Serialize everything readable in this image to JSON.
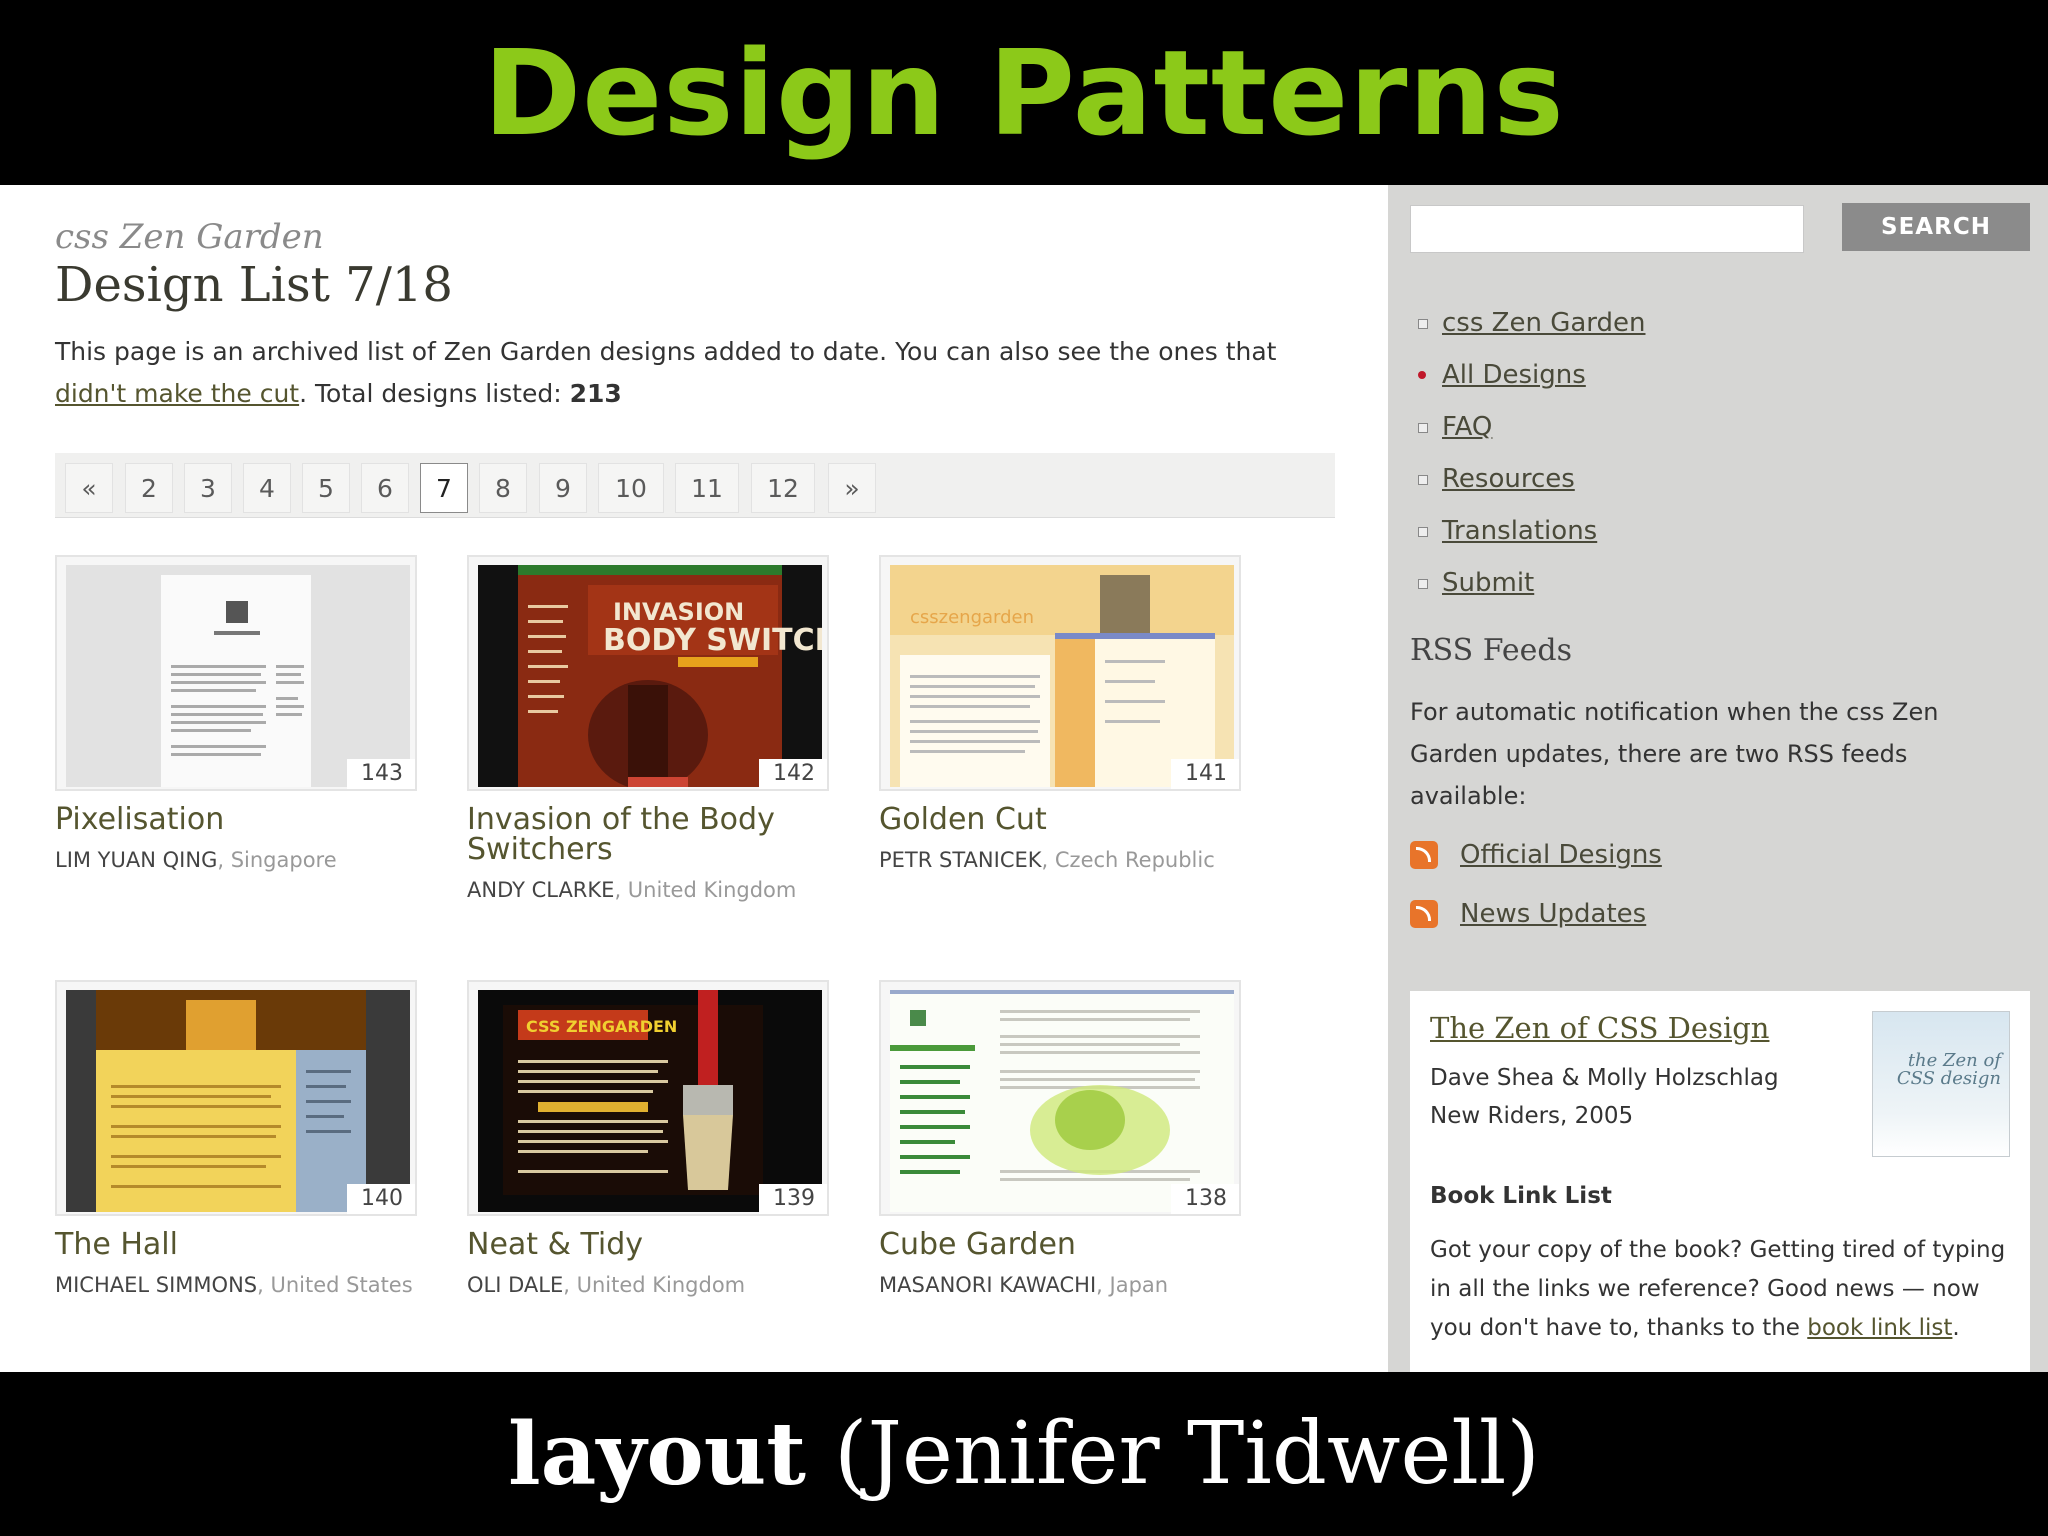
{
  "slide": {
    "title": "Design Patterns",
    "footer_bold": "layout",
    "footer_rest": "(Jenifer Tidwell)"
  },
  "main": {
    "brand": "css Zen Garden",
    "page_title": "Design List 7/18",
    "intro_pre": "This page is an archived list of Zen Garden designs added to date. You can also see the ones that",
    "intro_link": "didn't make the cut",
    "intro_mid": ". Total designs listed: ",
    "intro_count": "213",
    "pager": [
      "«",
      "2",
      "3",
      "4",
      "5",
      "6",
      "7",
      "8",
      "9",
      "10",
      "11",
      "12",
      "»"
    ],
    "pager_current": "7",
    "designs": [
      {
        "num": "143",
        "name": "Pixelisation",
        "author": "LIM YUAN QING",
        "location": ", Singapore"
      },
      {
        "num": "142",
        "name": "Invasion of the Body Switchers",
        "author": "ANDY CLARKE",
        "location": ", United Kingdom"
      },
      {
        "num": "141",
        "name": "Golden Cut",
        "author": "PETR STANICEK",
        "location": ", Czech Republic"
      },
      {
        "num": "140",
        "name": "The Hall",
        "author": "MICHAEL SIMMONS",
        "location": ", United States"
      },
      {
        "num": "139",
        "name": "Neat & Tidy",
        "author": "OLI DALE",
        "location": ", United Kingdom"
      },
      {
        "num": "138",
        "name": "Cube Garden",
        "author": "MASANORI KAWACHI",
        "location": ", Japan"
      }
    ]
  },
  "sidebar": {
    "search_button": "SEARCH",
    "search_value": "",
    "nav": [
      {
        "label": "css Zen Garden",
        "current": false
      },
      {
        "label": "All Designs",
        "current": true
      },
      {
        "label": "FAQ",
        "current": false
      },
      {
        "label": "Resources",
        "current": false
      },
      {
        "label": "Translations",
        "current": false
      },
      {
        "label": "Submit",
        "current": false
      }
    ],
    "rss_title": "RSS Feeds",
    "rss_desc": "For automatic notification when the css Zen Garden updates, there are two RSS feeds available:",
    "rss_links": [
      "Official Designs",
      "News Updates"
    ],
    "book": {
      "title": "The Zen of CSS Design",
      "authors": "Dave Shea & Molly Holzschlag",
      "publisher": "New Riders, 2005",
      "cover_text": "the Zen of CSS design",
      "list_title": "Book Link List",
      "text": "Got your copy of the book? Getting tired of typing in all the links we reference? Good news — now you don't have to, thanks to the ",
      "link": "book link list",
      "end": "."
    }
  }
}
